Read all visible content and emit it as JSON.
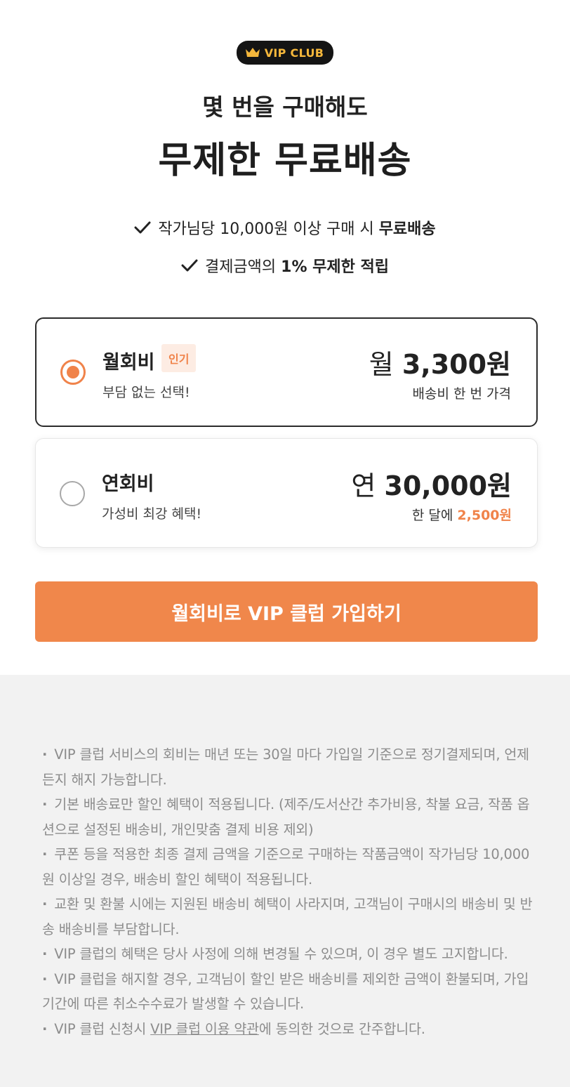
{
  "badge": {
    "label": "VIP CLUB",
    "icon": "crown-icon",
    "bg": "#141414",
    "color": "#f5b73b"
  },
  "hero": {
    "subtitle": "몇 번을 구매해도",
    "title": "무제한 무료배송"
  },
  "benefits": [
    {
      "icon": "checkmark-icon",
      "text": "작가님당 10,000원 이상 구매 시 ",
      "bold": "무료배송"
    },
    {
      "icon": "checkmark-icon",
      "text": "결제금액의 ",
      "bold": "1% 무제한 적립"
    }
  ],
  "plans": {
    "monthly": {
      "name": "월회비",
      "tag": "인기",
      "desc": "부담 없는 선택!",
      "price_prefix": "월 ",
      "price": "3,300",
      "price_unit": "원",
      "price_note": "배송비 한 번 가격",
      "selected": true
    },
    "yearly": {
      "name": "연회비",
      "desc": "가성비 최강 혜택!",
      "price_prefix": "연 ",
      "price": "30,000",
      "price_unit": "원",
      "price_note_prefix": "한 달에 ",
      "price_note_accent": "2,500원",
      "selected": false
    }
  },
  "cta": {
    "label": "월회비로 VIP 클럽 가입하기",
    "color": "#f0874b"
  },
  "notices": [
    "VIP 클럽 서비스의 회비는 매년 또는 30일 마다 가입일 기준으로 정기결제되며, 언제든지 해지 가능합니다.",
    "기본 배송료만 할인 혜택이 적용됩니다. (제주/도서산간 추가비용, 착불 요금, 작품 옵션으로 설정된 배송비, 개인맞춤 결제 비용 제외)",
    "쿠폰 등을 적용한 최종 결제 금액을 기준으로 구매하는 작품금액이 작가님당 10,000원 이상일 경우, 배송비 할인 혜택이 적용됩니다.",
    "교환 및 환불 시에는 지원된 배송비 혜택이 사라지며, 고객님이 구매시의 배송비 및 반송 배송비를 부담합니다.",
    "VIP 클럽의 혜택은 당사 사정에 의해 변경될 수 있으며, 이 경우 별도 고지합니다.",
    "VIP 클럽을 해지할 경우, 고객님이 할인 받은 배송비를 제외한 금액이 환불되며, 가입 기간에 따른 취소수수료가 발생할 수 있습니다."
  ],
  "terms_notice": {
    "prefix": "VIP 클럽 신청시 ",
    "link": "VIP 클럽 이용 약관",
    "suffix": "에 동의한 것으로 간주합니다."
  },
  "colors": {
    "accent": "#f0834a",
    "notice_bg": "#f2f2f2",
    "notice_text": "#8c8c8c"
  }
}
